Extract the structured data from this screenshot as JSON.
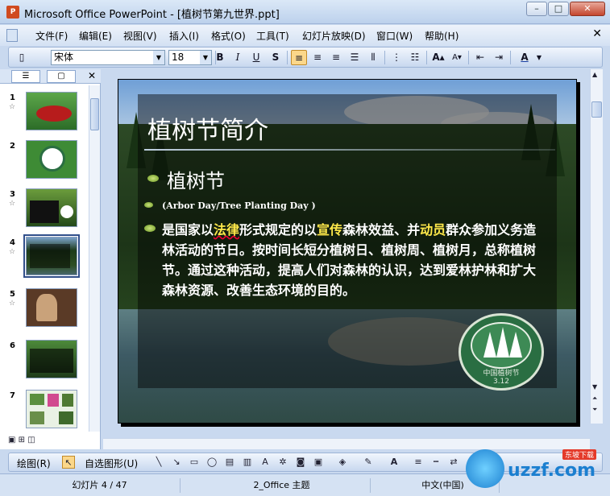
{
  "window": {
    "title": "Microsoft Office PowerPoint - [植树节第九世界.ppt]",
    "minimize": "–",
    "maximize": "□",
    "close": "✕"
  },
  "menu": {
    "items": [
      "文件(F)",
      "编辑(E)",
      "视图(V)",
      "插入(I)",
      "格式(O)",
      "工具(T)",
      "幻灯片放映(D)",
      "窗口(W)",
      "帮助(H)"
    ],
    "close": "✕"
  },
  "format_toolbar": {
    "font": "宋体",
    "size": "18",
    "bold": "B",
    "italic": "I",
    "underline": "U",
    "shadow": "S",
    "font_color_label": "A"
  },
  "left_pane": {
    "tab_outline_icon": "outline-icon",
    "tab_slides_icon": "slides-icon",
    "close": "✕",
    "slides": [
      {
        "num": "1",
        "star": "☆"
      },
      {
        "num": "2",
        "star": ""
      },
      {
        "num": "3",
        "star": "☆"
      },
      {
        "num": "4",
        "star": "☆"
      },
      {
        "num": "5",
        "star": "☆"
      },
      {
        "num": "6",
        "star": ""
      },
      {
        "num": "7",
        "star": ""
      }
    ],
    "selected_index": 3
  },
  "slide": {
    "title": "植树节简介",
    "heading": "植树节",
    "subheading": "(Arbor Day/Tree Planting Day )",
    "body_parts": {
      "p1": "是国家以",
      "h1": "法律",
      "p2": "形式规定的以",
      "h2": "宣传",
      "p3": "森林效益、并",
      "h3": "动员",
      "p4": "群众参加义务造林活动的节日。按时间长短分植树日、植树周、植树月，总称植树节。通过这种活动，提高人们对森林的认识，达到爱林护林和扩大森林资源、改善生态环境的目的。"
    },
    "emblem_label": "中国植树节",
    "emblem_date": "3.12"
  },
  "draw_toolbar": {
    "draw_label": "绘图(R)",
    "autoshapes_label": "自选图形(U)"
  },
  "status": {
    "slide_info": "幻灯片 4 / 47",
    "theme": "2_Office 主题",
    "language": "中文(中国)"
  },
  "watermark": {
    "text": "uzzf.com",
    "tag": "东坡下载"
  }
}
